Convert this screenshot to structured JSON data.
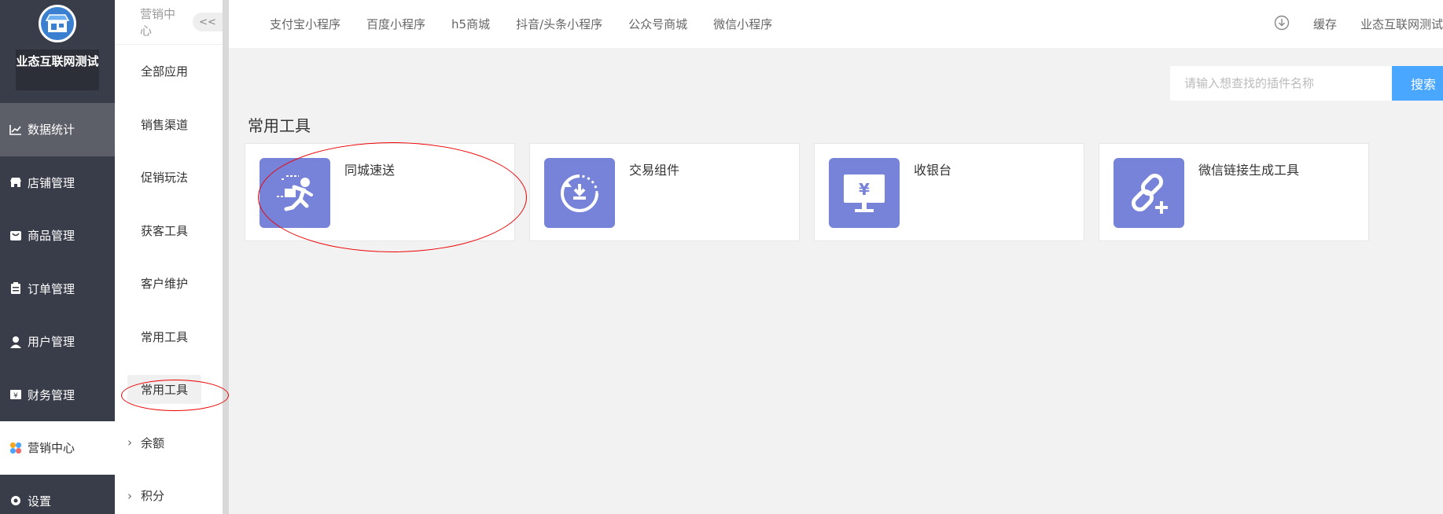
{
  "sidebar": {
    "shop_name": "业态互联网测试",
    "items": [
      {
        "label": "数据统计",
        "icon": "chart-line-icon"
      },
      {
        "label": "店铺管理",
        "icon": "store-icon"
      },
      {
        "label": "商品管理",
        "icon": "bag-icon"
      },
      {
        "label": "订单管理",
        "icon": "clipboard-icon"
      },
      {
        "label": "用户管理",
        "icon": "user-icon"
      },
      {
        "label": "财务管理",
        "icon": "yen-card-icon"
      },
      {
        "label": "营销中心",
        "icon": "marketing-petals-icon"
      },
      {
        "label": "设置",
        "icon": "gear-icon"
      }
    ]
  },
  "submenu": {
    "header": "营销中心",
    "collapse_label": "<<",
    "items": [
      "全部应用",
      "销售渠道",
      "促销玩法",
      "获客工具",
      "客户维护",
      "常用工具",
      "常用工具",
      "余额",
      "积分"
    ]
  },
  "topbar": {
    "tabs": [
      "支付宝小程序",
      "百度小程序",
      "h5商城",
      "抖音/头条小程序",
      "公众号商城",
      "微信小程序"
    ],
    "cache_label": "缓存",
    "account_name": "业态互联网测试"
  },
  "search": {
    "placeholder": "请输入想查找的插件名称",
    "button_label": "搜索"
  },
  "section_title": "常用工具",
  "plugins": [
    {
      "name": "同城速送",
      "icon": "runner-icon"
    },
    {
      "name": "交易组件",
      "icon": "refresh-download-icon"
    },
    {
      "name": "收银台",
      "icon": "monitor-yen-icon"
    },
    {
      "name": "微信链接生成工具",
      "icon": "link-plus-icon"
    }
  ],
  "colors": {
    "sidebar_bg": "#393d49",
    "accent": "#4aa7ff",
    "plugin_icon_bg": "#7683d8",
    "annotation": "#e00000"
  }
}
